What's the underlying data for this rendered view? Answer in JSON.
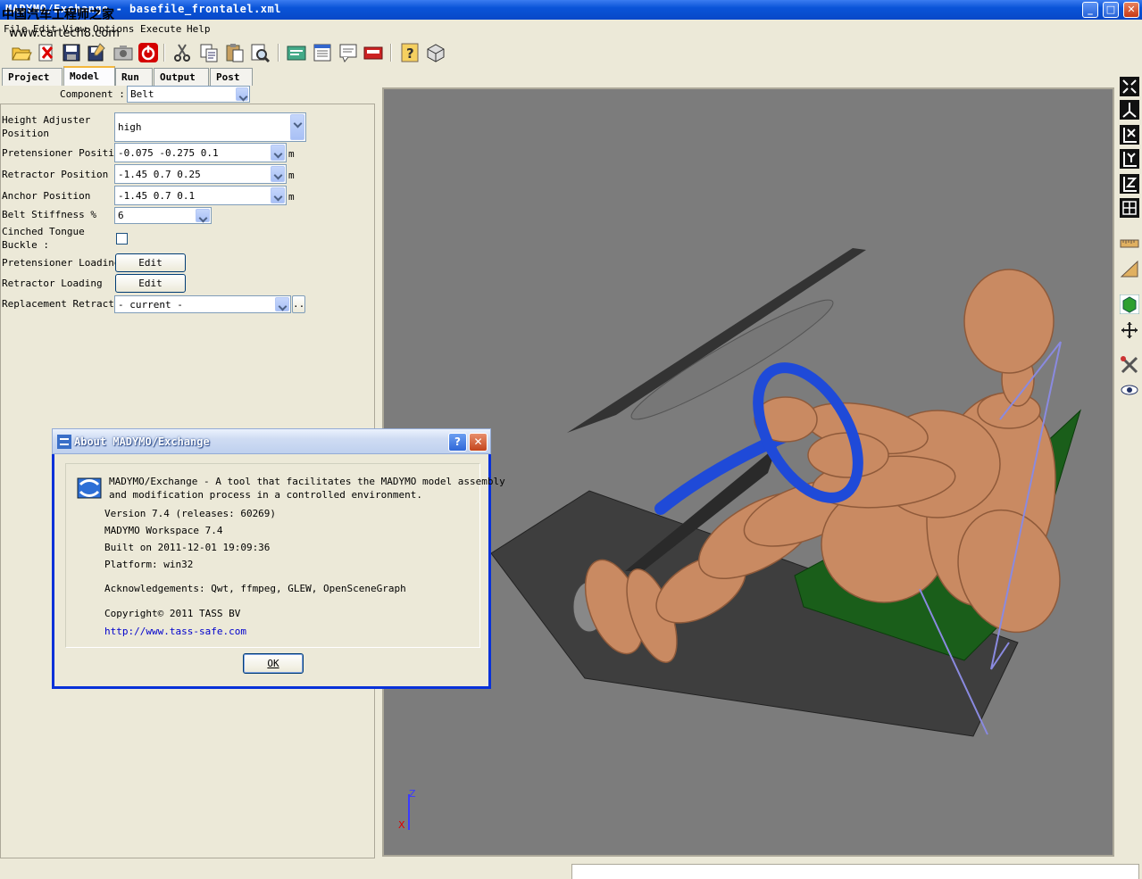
{
  "window": {
    "title": "MADYMO/Exchange - basefile_frontalel.xml",
    "watermark_cn": "中国汽车工程师之家",
    "watermark_url": "www.cartech8.com",
    "minimize": "_",
    "maximize": "□",
    "close": "✕"
  },
  "menu": [
    "File",
    "Edit",
    "View",
    "Options",
    "Execute",
    "Help"
  ],
  "toolbar": {
    "icons": [
      "open-folder-icon",
      "close-file-icon",
      "save-icon",
      "save-as-icon",
      "camera-icon",
      "power-icon",
      "cut-icon",
      "copy-icon",
      "paste-icon",
      "find-icon",
      "run-icon",
      "list-icon",
      "message-icon",
      "record-icon",
      "help-icon",
      "package-icon"
    ]
  },
  "tabs": [
    {
      "label": "Project",
      "active": false
    },
    {
      "label": "Model",
      "active": true
    },
    {
      "label": "Run",
      "active": false
    },
    {
      "label": "Output",
      "active": false
    },
    {
      "label": "Post",
      "active": false
    }
  ],
  "component": {
    "label": "Component :",
    "value": "Belt"
  },
  "fields": {
    "height_adjuster": {
      "label": "Height Adjuster Position",
      "value": "high"
    },
    "pretensioner_position": {
      "label": "Pretensioner Position",
      "value": "-0.075 -0.275 0.1",
      "unit": "m"
    },
    "retractor_position": {
      "label": "Retractor Position",
      "value": "-1.45 0.7 0.25",
      "unit": "m"
    },
    "anchor_position": {
      "label": "Anchor Position",
      "value": "-1.45 0.7 0.1",
      "unit": "m"
    },
    "belt_stiffness": {
      "label": "Belt Stiffness %",
      "value": "6"
    },
    "cinched_tongue": {
      "label": "Cinched Tongue Buckle :",
      "checked": false
    },
    "pretensioner_loading": {
      "label": "Pretensioner Loading",
      "button": "Edit"
    },
    "retractor_loading": {
      "label": "Retractor Loading",
      "button": "Edit"
    },
    "replacement_retractor": {
      "label": "Replacement Retractor",
      "value": "- current -",
      "button": ".."
    }
  },
  "viewport": {
    "axis_z": "Z",
    "axis_x": "X",
    "background": "#7c7c7c"
  },
  "right_toolbar": [
    "fit-view-icon",
    "axes-icon",
    "view-x-icon",
    "view-y-icon",
    "view-z-icon",
    "grid-icon",
    "ruler-icon",
    "angle-icon",
    "cube-icon",
    "move-icon",
    "tools-icon",
    "eye-icon"
  ],
  "about": {
    "title": "About MADYMO/Exchange",
    "help_btn": "?",
    "close_btn": "✕",
    "desc1": "MADYMO/Exchange - A tool that facilitates the MADYMO model assembly",
    "desc2": "and modification process in a controlled environment.",
    "version": "Version 7.4 (releases: 60269)",
    "workspace": "MADYMO Workspace 7.4",
    "built": "Built on 2011-12-01 19:09:36",
    "platform": "Platform: win32",
    "ack": "Acknowledgements: Qwt, ffmpeg, GLEW, OpenSceneGraph",
    "copyright": "Copyright© 2011 TASS BV",
    "url": "http://www.tass-safe.com",
    "ok": "OK"
  }
}
